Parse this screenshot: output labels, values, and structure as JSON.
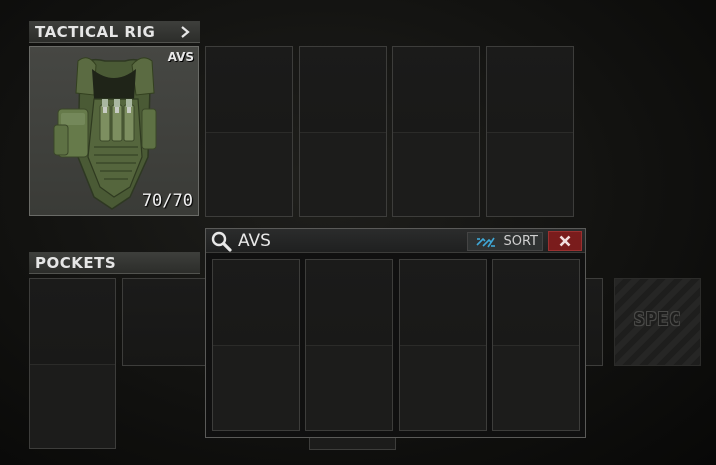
{
  "tactical_rig": {
    "title": "TACTICAL RIG",
    "item_tag": "AVS",
    "capacity": "70/70",
    "grid_cells": 4
  },
  "pockets": {
    "title": "POCKETS"
  },
  "search_popup": {
    "query": "AVS",
    "sort_label": "SORT",
    "result_cells": 4
  },
  "special_slot": {
    "label": "SPEC"
  },
  "colors": {
    "close_button": "#7a1c1c",
    "sort_icon": "#3fa7d6",
    "header": "#3a3b38"
  },
  "icons": [
    "chevron-right-icon",
    "search-icon",
    "sort-icon",
    "close-icon"
  ]
}
